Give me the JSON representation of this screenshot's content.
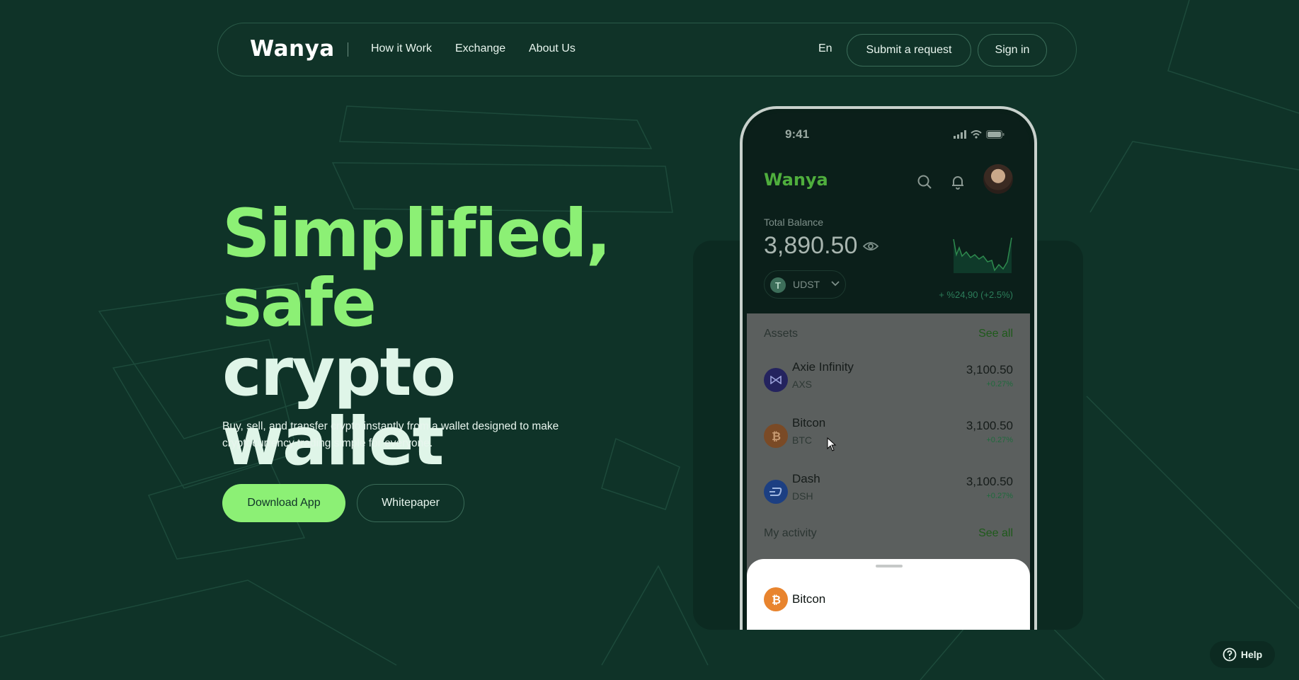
{
  "nav": {
    "logo": "Wanya",
    "links": [
      "How it Work",
      "Exchange",
      "About Us"
    ],
    "lang": "En",
    "submit_label": "Submit a request",
    "signin_label": "Sign in"
  },
  "hero": {
    "title_line1": "Simplified,",
    "title_line2_green": "safe",
    "title_line2_light": "crypto",
    "title_line3": "wallet",
    "subtitle": "Buy, sell, and transfer crypto instantly from a wallet designed to make cryptocurrency trading simple for everyone.",
    "download_label": "Download App",
    "whitepaper_label": "Whitepaper"
  },
  "phone": {
    "time": "9:41",
    "app_logo": "Wanya",
    "balance_label": "Total Balance",
    "balance_value": "3,890.50",
    "currency": "UDST",
    "currency_symbol": "T",
    "balance_change": "+ %24,90 (+2.5%)",
    "assets_title": "Assets",
    "assets_see_all": "See all",
    "assets": [
      {
        "name": "Axie Infinity",
        "symbol": "AXS",
        "value": "3,100.50",
        "change": "+0.27%"
      },
      {
        "name": "Bitcon",
        "symbol": "BTC",
        "value": "3,100.50",
        "change": "+0.27%"
      },
      {
        "name": "Dash",
        "symbol": "DSH",
        "value": "3,100.50",
        "change": "+0.27%"
      }
    ],
    "activity_title": "My activity",
    "activity_see_all": "See all",
    "sheet_item": "Bitcon"
  },
  "help_label": "Help",
  "colors": {
    "background": "#0f3328",
    "accent_green": "#8cf075",
    "brand_green": "#4fae3d",
    "bitcoin_orange": "#e8842e",
    "axie_navy": "#24235e",
    "dash_blue": "#1c3f82"
  },
  "icons": [
    "search-icon",
    "bell-icon",
    "eye-icon",
    "chevron-down-icon",
    "signal-icon",
    "wifi-icon",
    "battery-icon",
    "help-icon"
  ]
}
